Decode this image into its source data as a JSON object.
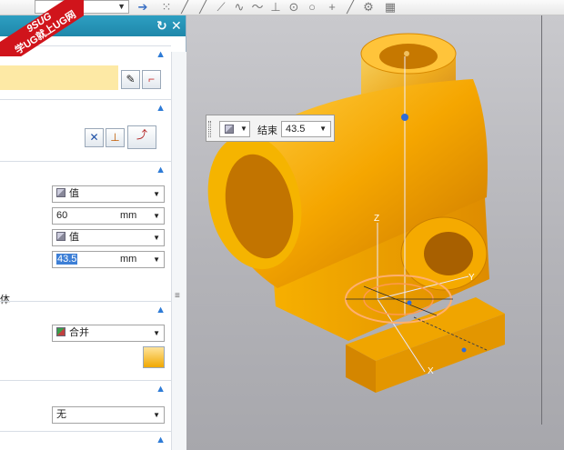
{
  "watermark": {
    "line1": "9SUG",
    "line2": "学UG就上UG网"
  },
  "toolbar": {
    "combo_value": "",
    "icons": [
      "arrow-right-icon",
      "point-grid-icon",
      "line-icon",
      "line-icon",
      "curve-icon",
      "spline-icon",
      "perpendicular-icon",
      "circle-icon",
      "circle-icon",
      "plus-icon",
      "line-icon",
      "snap-icon",
      "grid-icon"
    ]
  },
  "dialog": {
    "controls": {
      "reset": "↻",
      "close": "✕"
    },
    "rows": {
      "type_combo": {
        "label": "值"
      },
      "start_input": {
        "value": "60",
        "unit": "mm"
      },
      "type_combo_2": {
        "label": "值"
      },
      "end_input": {
        "value": "43.5",
        "unit": "mm"
      },
      "side_text": "体",
      "boolean_combo": {
        "label": "合并"
      },
      "draft_combo": {
        "label": "无"
      }
    }
  },
  "viewport": {
    "floating_label": "结束",
    "floating_value": "43.5",
    "axis_labels": {
      "z": "Z",
      "y": "Y",
      "x": "X"
    }
  },
  "colors": {
    "part": "#f0a800",
    "title_bar": "#2596be",
    "highlight": "#fde9a5"
  }
}
